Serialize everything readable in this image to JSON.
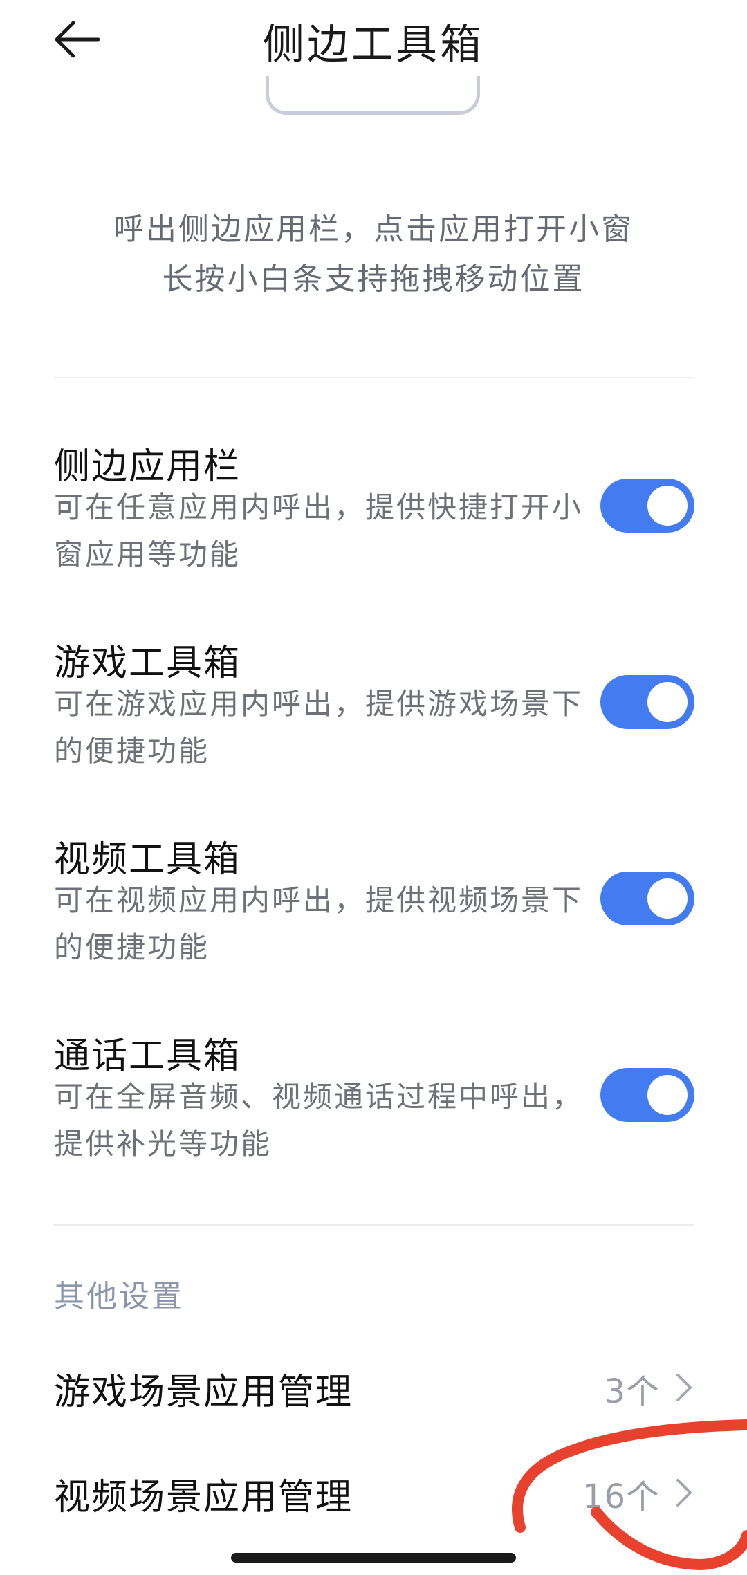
{
  "header": {
    "title": "侧边工具箱"
  },
  "description": {
    "lines": [
      "呼出侧边应用栏，点击应用打开小窗",
      "长按小白条支持拖拽移动位置"
    ]
  },
  "settings": [
    {
      "title": "侧边应用栏",
      "desc": "可在任意应用内呼出，提供快捷打开小窗应用等功能",
      "enabled": true
    },
    {
      "title": "游戏工具箱",
      "desc": "可在游戏应用内呼出，提供游戏场景下的便捷功能",
      "enabled": true
    },
    {
      "title": "视频工具箱",
      "desc": "可在视频应用内呼出，提供视频场景下的便捷功能",
      "enabled": true
    },
    {
      "title": "通话工具箱",
      "desc": "可在全屏音频、视频通话过程中呼出，提供补光等功能",
      "enabled": true
    }
  ],
  "other_settings": {
    "header": "其他设置",
    "items": [
      {
        "label": "游戏场景应用管理",
        "value": "3个"
      },
      {
        "label": "视频场景应用管理",
        "value": "16个"
      }
    ]
  },
  "colors": {
    "accent": "#437cf1",
    "annotation": "#e8412e"
  },
  "icons": [
    "back-arrow-icon",
    "chevron-right-icon"
  ]
}
